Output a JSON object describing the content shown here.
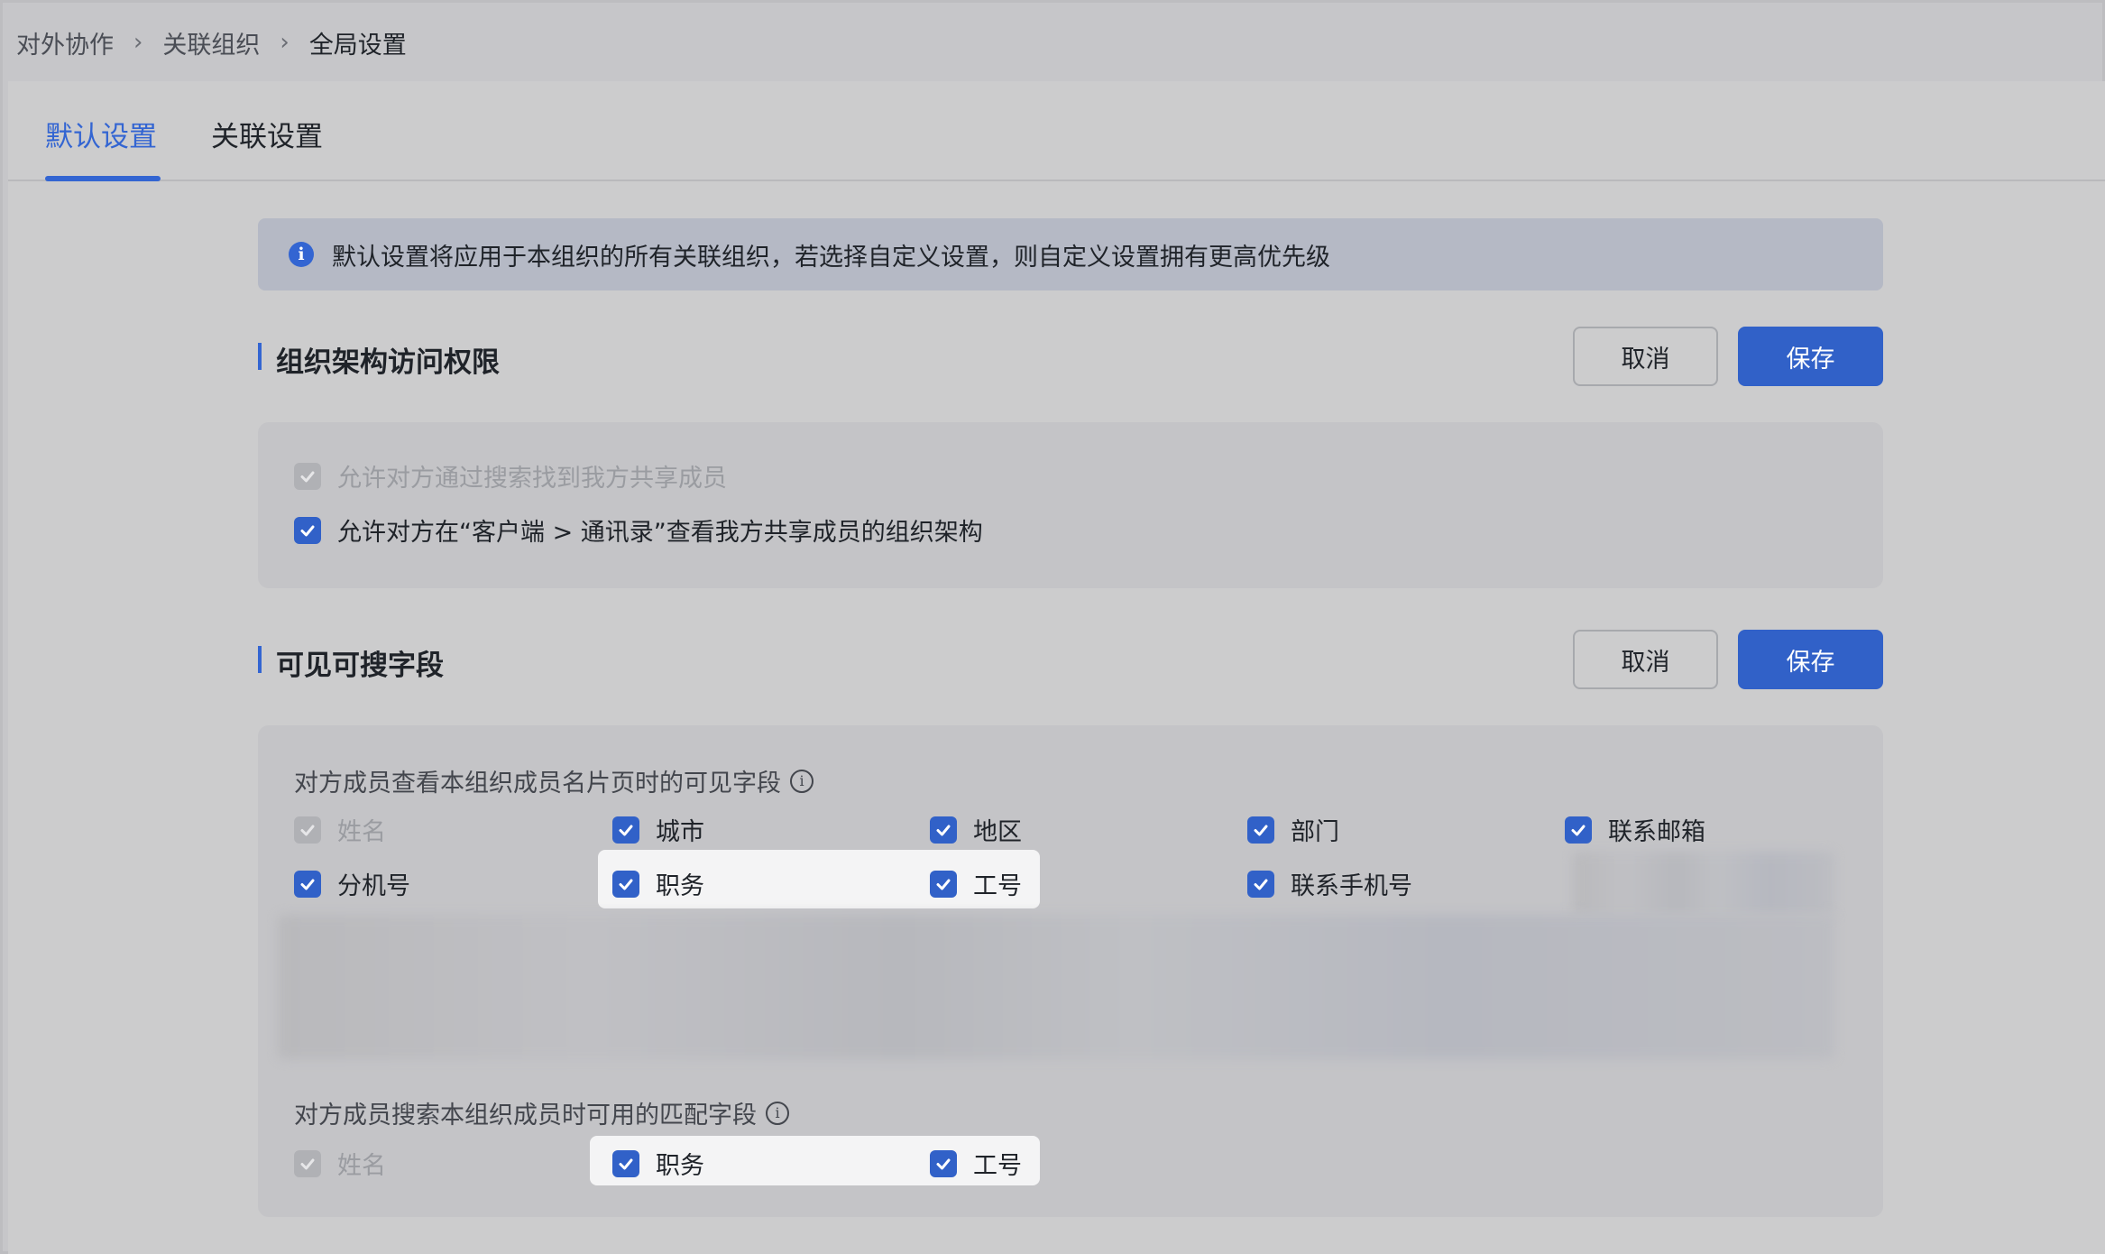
{
  "breadcrumb": [
    "对外协作",
    "关联组织",
    "全局设置"
  ],
  "tabs": [
    {
      "label": "默认设置",
      "active": true
    },
    {
      "label": "关联设置",
      "active": false
    }
  ],
  "banner": {
    "icon": "info-icon",
    "text": "默认设置将应用于本组织的所有关联组织，若选择自定义设置，则自定义设置拥有更高优先级"
  },
  "section1": {
    "title": "组织架构访问权限",
    "cancel": "取消",
    "save": "保存",
    "options": [
      {
        "label": "允许对方通过搜索找到我方共享成员",
        "checked": true,
        "disabled": true
      },
      {
        "label": "允许对方在“客户端 > 通讯录”查看我方共享成员的组织架构",
        "checked": true,
        "disabled": false
      }
    ]
  },
  "section2": {
    "title": "可见可搜字段",
    "cancel": "取消",
    "save": "保存",
    "visible_caption": "对方成员查看本组织成员名片页时的可见字段",
    "visible_fields": [
      {
        "label": "姓名",
        "checked": true,
        "disabled": true
      },
      {
        "label": "城市",
        "checked": true,
        "disabled": false
      },
      {
        "label": "地区",
        "checked": true,
        "disabled": false
      },
      {
        "label": "部门",
        "checked": true,
        "disabled": false
      },
      {
        "label": "联系邮箱",
        "checked": true,
        "disabled": false
      },
      {
        "label": "分机号",
        "checked": true,
        "disabled": false
      },
      {
        "label": "职务",
        "checked": true,
        "disabled": false
      },
      {
        "label": "工号",
        "checked": true,
        "disabled": false
      },
      {
        "label": "联系手机号",
        "checked": true,
        "disabled": false
      }
    ],
    "search_caption": "对方成员搜索本组织成员时可用的匹配字段",
    "search_fields": [
      {
        "label": "姓名",
        "checked": true,
        "disabled": true
      },
      {
        "label": "职务",
        "checked": true,
        "disabled": false
      },
      {
        "label": "工号",
        "checked": true,
        "disabled": false
      }
    ]
  },
  "colors": {
    "accent": "#3365d2",
    "save_button": "#3161c8"
  }
}
